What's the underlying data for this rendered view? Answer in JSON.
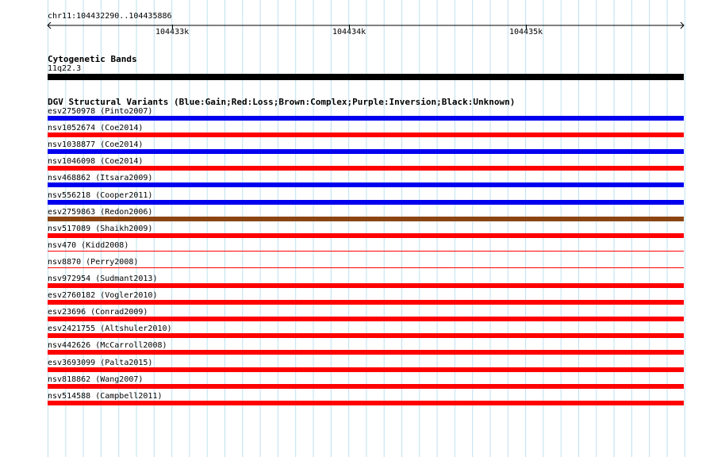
{
  "ruler": {
    "range_label": "chr11:104432290..104435886",
    "ticks": [
      "104433k",
      "104434k",
      "104435k"
    ]
  },
  "cytoband": {
    "title": "Cytogenetic Bands",
    "band_label": "11q22.3",
    "color": "#000000"
  },
  "dgv": {
    "title": "DGV Structural Variants (Blue:Gain;Red:Loss;Brown:Complex;Purple:Inversion;Black:Unknown)",
    "variants": [
      {
        "label": "esv2750978 (Pinto2007)",
        "color": "#0000ee",
        "thickness": "thick"
      },
      {
        "label": "nsv1052674 (Coe2014)",
        "color": "#ff0000",
        "thickness": "thick"
      },
      {
        "label": "nsv1038877 (Coe2014)",
        "color": "#0000ee",
        "thickness": "thick"
      },
      {
        "label": "nsv1046098 (Coe2014)",
        "color": "#ff0000",
        "thickness": "thick"
      },
      {
        "label": "nsv468862 (Itsara2009)",
        "color": "#0000ee",
        "thickness": "thick"
      },
      {
        "label": "nsv556218 (Cooper2011)",
        "color": "#0000ee",
        "thickness": "thick"
      },
      {
        "label": "esv2759863 (Redon2006)",
        "color": "#8b4513",
        "thickness": "thick"
      },
      {
        "label": "nsv517089 (Shaikh2009)",
        "color": "#ff0000",
        "thickness": "thick"
      },
      {
        "label": "nsv470 (Kidd2008)",
        "color": "#ff0000",
        "thickness": "thin"
      },
      {
        "label": "nsv8870 (Perry2008)",
        "color": "#ff0000",
        "thickness": "thin"
      },
      {
        "label": "nsv972954 (Sudmant2013)",
        "color": "#ff0000",
        "thickness": "thick"
      },
      {
        "label": "esv2760182 (Vogler2010)",
        "color": "#ff0000",
        "thickness": "thick"
      },
      {
        "label": "esv23696 (Conrad2009)",
        "color": "#ff0000",
        "thickness": "thick"
      },
      {
        "label": "esv2421755 (Altshuler2010)",
        "color": "#ff0000",
        "thickness": "thick"
      },
      {
        "label": "nsv442626 (McCarroll2008)",
        "color": "#ff0000",
        "thickness": "thick"
      },
      {
        "label": "esv3693099 (Palta2015)",
        "color": "#ff0000",
        "thickness": "thick"
      },
      {
        "label": "nsv818862 (Wang2007)",
        "color": "#ff0000",
        "thickness": "thick"
      },
      {
        "label": "nsv514588 (Campbell2011)",
        "color": "#ff0000",
        "thickness": "thick"
      }
    ]
  },
  "colors": {
    "gridline": "#bfe0ee"
  }
}
